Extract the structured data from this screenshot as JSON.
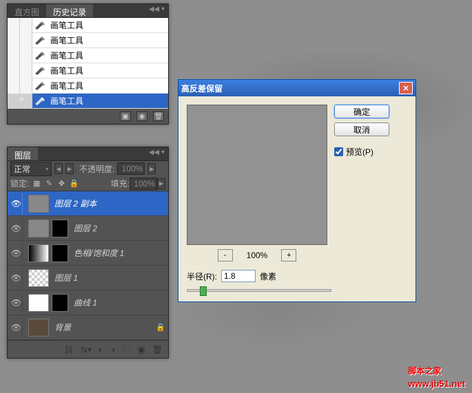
{
  "history": {
    "tab_histogram": "直方图",
    "tab_history": "历史记录",
    "items": [
      {
        "label": "画笔工具"
      },
      {
        "label": "画笔工具"
      },
      {
        "label": "画笔工具"
      },
      {
        "label": "画笔工具"
      },
      {
        "label": "画笔工具"
      },
      {
        "label": "画笔工具"
      }
    ]
  },
  "layers": {
    "tab_label": "图层",
    "blend_mode": "正常",
    "opacity_label": "不透明度:",
    "opacity_value": "100%",
    "lock_label": "锁定:",
    "fill_label": "填充:",
    "fill_value": "100%",
    "rows": [
      {
        "name": "图层 2 副本"
      },
      {
        "name": "图层 2"
      },
      {
        "name": "色相/饱和度 1"
      },
      {
        "name": "图层 1"
      },
      {
        "name": "曲线 1"
      },
      {
        "name": "背景"
      }
    ]
  },
  "dialog": {
    "title": "高反差保留",
    "ok": "确定",
    "cancel": "取消",
    "preview": "预览(P)",
    "zoom": "100%",
    "radius_label": "半径(R):",
    "radius_value": "1.8",
    "radius_unit": "像素"
  },
  "watermark": {
    "text": "脚本之家",
    "url": "www.jb51.net"
  }
}
